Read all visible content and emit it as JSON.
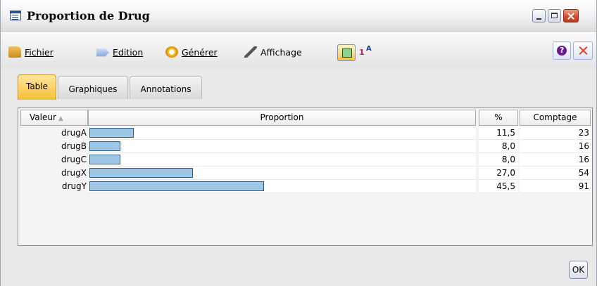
{
  "window": {
    "title": "Proportion de Drug"
  },
  "menu": {
    "fichier": "Fichier",
    "edition": "Edition",
    "generer": "Générer",
    "affichage": "Affichage"
  },
  "tabs": [
    "Table",
    "Graphiques",
    "Annotations"
  ],
  "table": {
    "columns": {
      "valeur": "Valeur",
      "proportion": "Proportion",
      "pct": "%",
      "comptage": "Comptage"
    },
    "rows": [
      {
        "valeur": "drugA",
        "pct": "11,5",
        "comptage": "23",
        "proportion": 0.115
      },
      {
        "valeur": "drugB",
        "pct": "8,0",
        "comptage": "16",
        "proportion": 0.08
      },
      {
        "valeur": "drugC",
        "pct": "8,0",
        "comptage": "16",
        "proportion": 0.08
      },
      {
        "valeur": "drugX",
        "pct": "27,0",
        "comptage": "54",
        "proportion": 0.27
      },
      {
        "valeur": "drugY",
        "pct": "45,5",
        "comptage": "91",
        "proportion": 0.455
      }
    ]
  },
  "buttons": {
    "ok": "OK"
  },
  "colors": {
    "bar_fill": "#9ec7e6",
    "bar_border": "#2e5d8a",
    "active_tab": "#f6be36",
    "close_red": "#d84a2c"
  }
}
